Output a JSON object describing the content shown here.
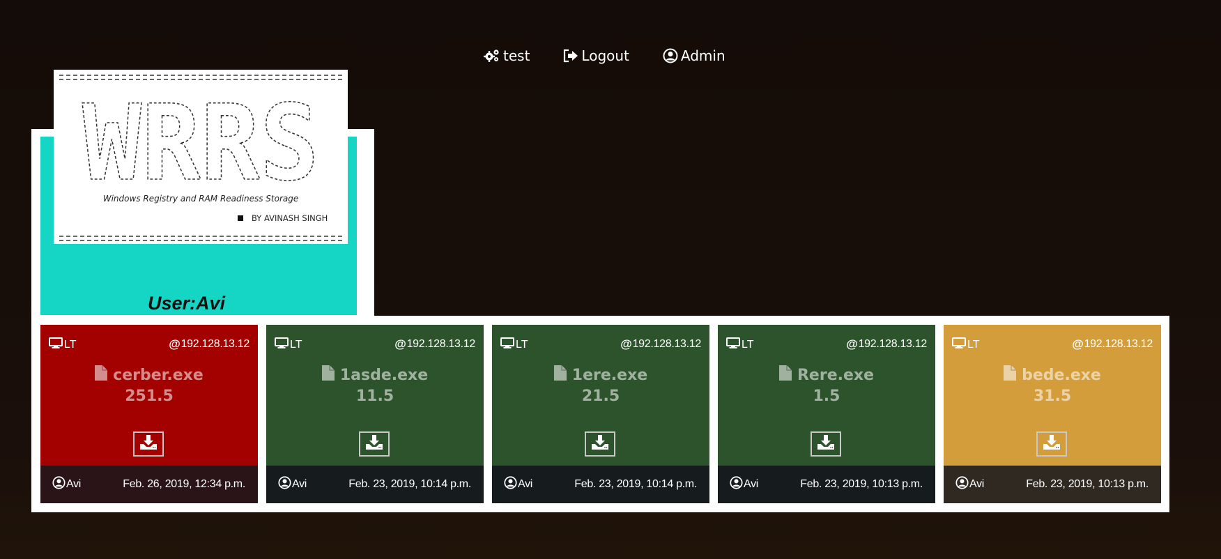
{
  "nav": {
    "items": [
      {
        "label": "test",
        "icon": "gears-icon"
      },
      {
        "label": "Logout",
        "icon": "logout-icon"
      },
      {
        "label": "Admin",
        "icon": "user-circle-icon"
      }
    ]
  },
  "logo": {
    "art_text": "WRRS",
    "subtitle": "Windows Registry and RAM Readiness Storage",
    "author": "BY AVINASH SINGH"
  },
  "user": {
    "label": "User:Avi"
  },
  "cards": [
    {
      "device": "LT",
      "ip": "192.128.13.12",
      "file": "cerber.exe",
      "size": "251.5",
      "owner": "Avi",
      "date": "Feb. 26, 2019, 12:34 p.m.",
      "color": "#a30000",
      "footer_color": "#2a1418"
    },
    {
      "device": "LT",
      "ip": "192.128.13.12",
      "file": "1asde.exe",
      "size": "11.5",
      "owner": "Avi",
      "date": "Feb. 23, 2019, 10:14 p.m.",
      "color": "#2d532c",
      "footer_color": "#161c1e"
    },
    {
      "device": "LT",
      "ip": "192.128.13.12",
      "file": "1ere.exe",
      "size": "21.5",
      "owner": "Avi",
      "date": "Feb. 23, 2019, 10:14 p.m.",
      "color": "#2d532c",
      "footer_color": "#161c1e"
    },
    {
      "device": "LT",
      "ip": "192.128.13.12",
      "file": "Rere.exe",
      "size": "1.5",
      "owner": "Avi",
      "date": "Feb. 23, 2019, 10:13 p.m.",
      "color": "#2d532c",
      "footer_color": "#161c1e"
    },
    {
      "device": "LT",
      "ip": "192.128.13.12",
      "file": "bede.exe",
      "size": "31.5",
      "owner": "Avi",
      "date": "Feb. 23, 2019, 10:13 p.m.",
      "color": "#d49d3c",
      "footer_color": "#2f2922"
    }
  ]
}
